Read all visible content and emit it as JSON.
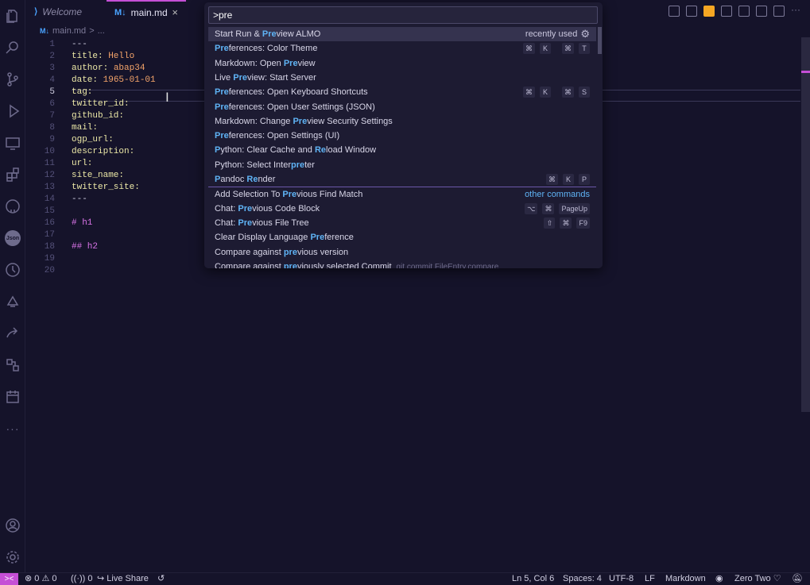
{
  "tabs": [
    {
      "label": "Welcome",
      "icon": "vscode-icon"
    },
    {
      "label": "main.md",
      "icon": "markdown-icon",
      "close": "×"
    }
  ],
  "breadcrumb": {
    "file": "main.md",
    "sep": ">",
    "rest": "..."
  },
  "editor": {
    "lines": [
      {
        "n": "1",
        "key": "---",
        "val": ""
      },
      {
        "n": "2",
        "key": "title:",
        "val": " Hello"
      },
      {
        "n": "3",
        "key": "author:",
        "val": " abap34"
      },
      {
        "n": "4",
        "key": "date:",
        "val": " 1965-01-01"
      },
      {
        "n": "5",
        "key": "tag:",
        "val": ""
      },
      {
        "n": "6",
        "key": "twitter_id:",
        "val": ""
      },
      {
        "n": "7",
        "key": "github_id:",
        "val": ""
      },
      {
        "n": "8",
        "key": "mail:",
        "val": ""
      },
      {
        "n": "9",
        "key": "ogp_url:",
        "val": ""
      },
      {
        "n": "10",
        "key": "description:",
        "val": ""
      },
      {
        "n": "11",
        "key": "url:",
        "val": ""
      },
      {
        "n": "12",
        "key": "site_name:",
        "val": ""
      },
      {
        "n": "13",
        "key": "twitter_site:",
        "val": ""
      },
      {
        "n": "14",
        "key": "---",
        "val": ""
      },
      {
        "n": "15",
        "key": "",
        "val": ""
      },
      {
        "n": "16",
        "key": "# h1",
        "val": ""
      },
      {
        "n": "17",
        "key": "",
        "val": ""
      },
      {
        "n": "18",
        "key": "## h2",
        "val": ""
      },
      {
        "n": "19",
        "key": "",
        "val": ""
      },
      {
        "n": "20",
        "key": "",
        "val": ""
      }
    ]
  },
  "palette": {
    "input_value": ">pre",
    "items": [
      {
        "pre": "Start Run & ",
        "hl": "Pre",
        "post": "view ALMO",
        "note": "recently used"
      },
      {
        "pre": "",
        "hl": "Pre",
        "post": "ferences: Color Theme",
        "keys": [
          "⌘",
          "K",
          "⌘",
          "T"
        ]
      },
      {
        "pre": "Markdown: Open ",
        "hl": "Pre",
        "post": "view"
      },
      {
        "pre": "Live ",
        "hl": "Pre",
        "post": "view: Start Server"
      },
      {
        "pre": "",
        "hl": "Pre",
        "post": "ferences: Open Keyboard Shortcuts",
        "keys": [
          "⌘",
          "K",
          "⌘",
          "S"
        ]
      },
      {
        "pre": "",
        "hl": "Pre",
        "post": "ferences: Open User Settings (JSON)"
      },
      {
        "pre": "Markdown: Change ",
        "hl": "Pre",
        "post": "view Security Settings"
      },
      {
        "pre": "",
        "hl": "Pre",
        "post": "ferences: Open Settings (UI)"
      },
      {
        "pre": "",
        "hl": "P",
        "post": "ython: Clear Cache and ",
        "hl2": "Re",
        "post2": "load Window"
      },
      {
        "pre": "Python: Select Inter",
        "hl": "pre",
        "post": "ter"
      },
      {
        "pre": "",
        "hl": "P",
        "post": "andoc ",
        "hl2": "Re",
        "post2": "nder",
        "keys": [
          "⌘",
          "K",
          "P"
        ]
      },
      {
        "pre": "Add Selection To ",
        "hl": "Pre",
        "post": "vious Find Match",
        "link": "other commands"
      },
      {
        "pre": "Chat: ",
        "hl": "Pre",
        "post": "vious Code Block",
        "keys": [
          "⌥",
          "⌘",
          "PageUp"
        ]
      },
      {
        "pre": "Chat: ",
        "hl": "Pre",
        "post": "vious File Tree",
        "keys": [
          "⇧",
          "⌘",
          "F9"
        ]
      },
      {
        "pre": "Clear Display Language ",
        "hl": "Pre",
        "post": "ference"
      },
      {
        "pre": "Compare against ",
        "hl": "pre",
        "post": "vious version"
      },
      {
        "pre": "Compare against ",
        "hl": "pre",
        "post": "viously selected Commit",
        "detail": "git.commit FileEntry.compare"
      }
    ]
  },
  "status": {
    "remote": "><",
    "errors": "0",
    "warnings": "0",
    "ports": "0",
    "live_share": "Live Share",
    "position": "Ln 5, Col 6",
    "spaces": "Spaces: 4",
    "encoding": "UTF-8",
    "eol": "LF",
    "language": "Markdown",
    "theme": "Zero Two"
  },
  "colors": {
    "accent": "#c54fd6",
    "highlight": "#5fb3f5",
    "background": "#15132a"
  }
}
